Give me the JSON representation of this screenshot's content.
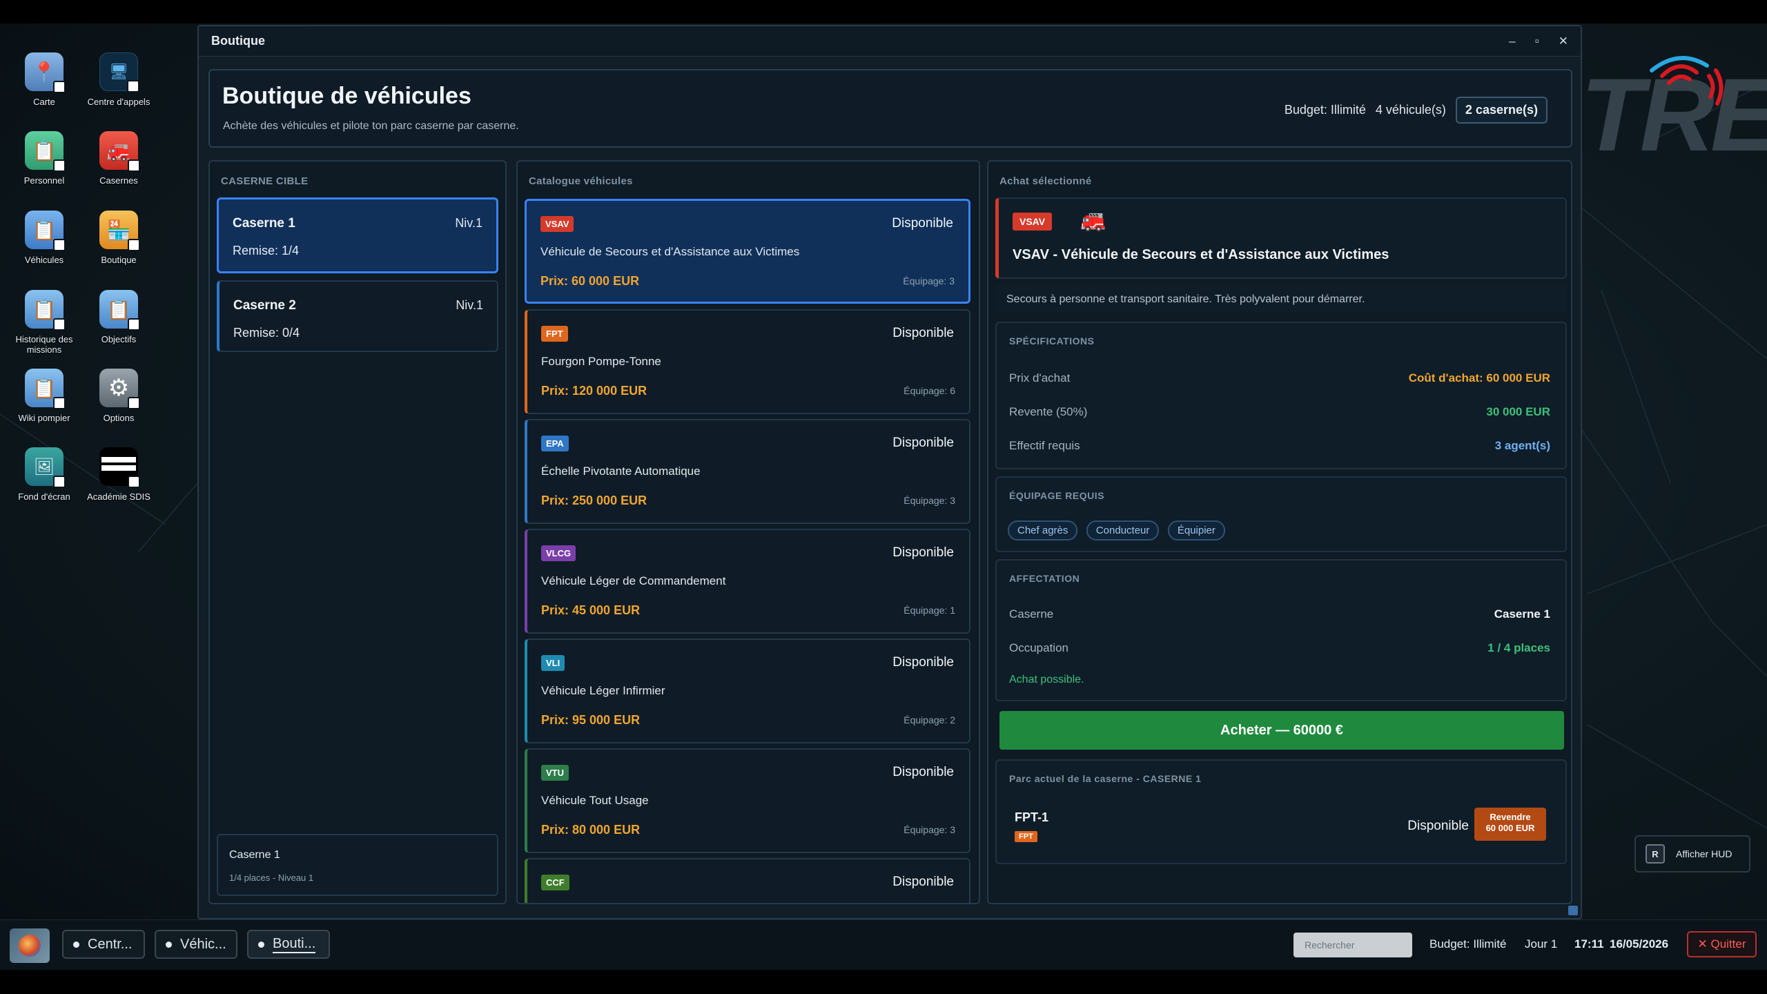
{
  "desktop": {
    "icons": [
      {
        "label": "Carte"
      },
      {
        "label": "Centre d'appels"
      },
      {
        "label": "Personnel"
      },
      {
        "label": "Casernes"
      },
      {
        "label": "Véhicules"
      },
      {
        "label": "Boutique"
      },
      {
        "label": "Historique des missions"
      },
      {
        "label": "Objectifs"
      },
      {
        "label": "Wiki pompier"
      },
      {
        "label": "Options"
      },
      {
        "label": "Fond d'écran"
      },
      {
        "label": "Académie SDIS"
      }
    ],
    "logo_text": "TRE",
    "logo_red": "18"
  },
  "window": {
    "title": "Boutique",
    "controls": {
      "minimize": "–",
      "maximize": "▫",
      "close": "✕"
    }
  },
  "header": {
    "title": "Boutique de véhicules",
    "subtitle": "Achète des véhicules et pilote ton parc caserne par caserne.",
    "budget": "Budget: Illimité",
    "vehicles": "4 véhicule(s)",
    "casernes": "2 caserne(s)"
  },
  "casernes_panel": {
    "title": "CASERNE CIBLE",
    "items": [
      {
        "name": "Caserne 1",
        "level": "Niv.1",
        "remise": "Remise: 1/4",
        "selected": true
      },
      {
        "name": "Caserne 2",
        "level": "Niv.1",
        "remise": "Remise: 0/4",
        "selected": false
      }
    ],
    "footer_name": "Caserne 1",
    "footer_info": "1/4 places - Niveau 1"
  },
  "catalogue": {
    "title": "Catalogue véhicules",
    "items": [
      {
        "tag": "VSAV",
        "tag_color": "#d63a2a",
        "accent": "#3b82f6",
        "status": "Disponible",
        "name": "Véhicule de Secours et d'Assistance aux Victimes",
        "price": "Prix: 60 000 EUR",
        "crew": "Équipage: 3"
      },
      {
        "tag": "FPT",
        "tag_color": "#e0661e",
        "accent": "#e0661e",
        "status": "Disponible",
        "name": "Fourgon Pompe-Tonne",
        "price": "Prix: 120 000 EUR",
        "crew": "Équipage: 6"
      },
      {
        "tag": "EPA",
        "tag_color": "#2f77c4",
        "accent": "#2f77c4",
        "status": "Disponible",
        "name": "Échelle Pivotante Automatique",
        "price": "Prix: 250 000 EUR",
        "crew": "Équipage: 3"
      },
      {
        "tag": "VLCG",
        "tag_color": "#7a3fa8",
        "accent": "#7a3fa8",
        "status": "Disponible",
        "name": "Véhicule Léger de Commandement",
        "price": "Prix: 45 000 EUR",
        "crew": "Équipage: 1"
      },
      {
        "tag": "VLI",
        "tag_color": "#1f8bb0",
        "accent": "#1f8bb0",
        "status": "Disponible",
        "name": "Véhicule Léger Infirmier",
        "price": "Prix: 95 000 EUR",
        "crew": "Équipage: 2"
      },
      {
        "tag": "VTU",
        "tag_color": "#2e7d4a",
        "accent": "#2e7d4a",
        "status": "Disponible",
        "name": "Véhicule Tout Usage",
        "price": "Prix: 80 000 EUR",
        "crew": "Équipage: 3"
      },
      {
        "tag": "CCF",
        "tag_color": "#3f7d2a",
        "accent": "#3f7d2a",
        "status": "Disponible",
        "name": "",
        "price": "",
        "crew": ""
      }
    ]
  },
  "selection": {
    "title": "Achat sélectionné",
    "tag": "VSAV",
    "name": "VSAV - Véhicule de Secours et d'Assistance aux Victimes",
    "description": "Secours à personne et transport sanitaire. Très polyvalent pour démarrer.",
    "specs_title": "SPÉCIFICATIONS",
    "specs": [
      {
        "label": "Prix d'achat",
        "value": "Coût d'achat: 60 000 EUR",
        "color": "#f0a530"
      },
      {
        "label": "Revente (50%)",
        "value": "30 000 EUR",
        "color": "#3ec07a"
      },
      {
        "label": "Effectif requis",
        "value": "3 agent(s)",
        "color": "#6fb0f5"
      }
    ],
    "equip_title": "ÉQUIPAGE REQUIS",
    "equip": [
      "Chef agrès",
      "Conducteur",
      "Équipier"
    ],
    "affect_title": "AFFECTATION",
    "affect": [
      {
        "label": "Caserne",
        "value": "Caserne 1",
        "color": "#f1f5f8"
      },
      {
        "label": "Occupation",
        "value": "1 / 4 places",
        "color": "#3ec07a"
      }
    ],
    "affect_note": "Achat possible.",
    "buy_label": "Acheter — 60000 €",
    "fleet_title": "Parc actuel de la caserne - CASERNE 1",
    "fleet": [
      {
        "name": "FPT-1",
        "tag": "FPT",
        "status": "Disponible",
        "sell_line1": "Revendre",
        "sell_line2": "60 000 EUR"
      }
    ]
  },
  "hud": {
    "key": "R",
    "label": "Afficher HUD"
  },
  "taskbar": {
    "apps": [
      {
        "label": "Centr..."
      },
      {
        "label": "Véhic..."
      },
      {
        "label": "Bouti..."
      }
    ],
    "search_placeholder": "Rechercher",
    "budget": "Budget: Illimité",
    "day": "Jour 1",
    "time": "17:11",
    "date": "16/05/2026",
    "quit": "✕ Quitter"
  }
}
